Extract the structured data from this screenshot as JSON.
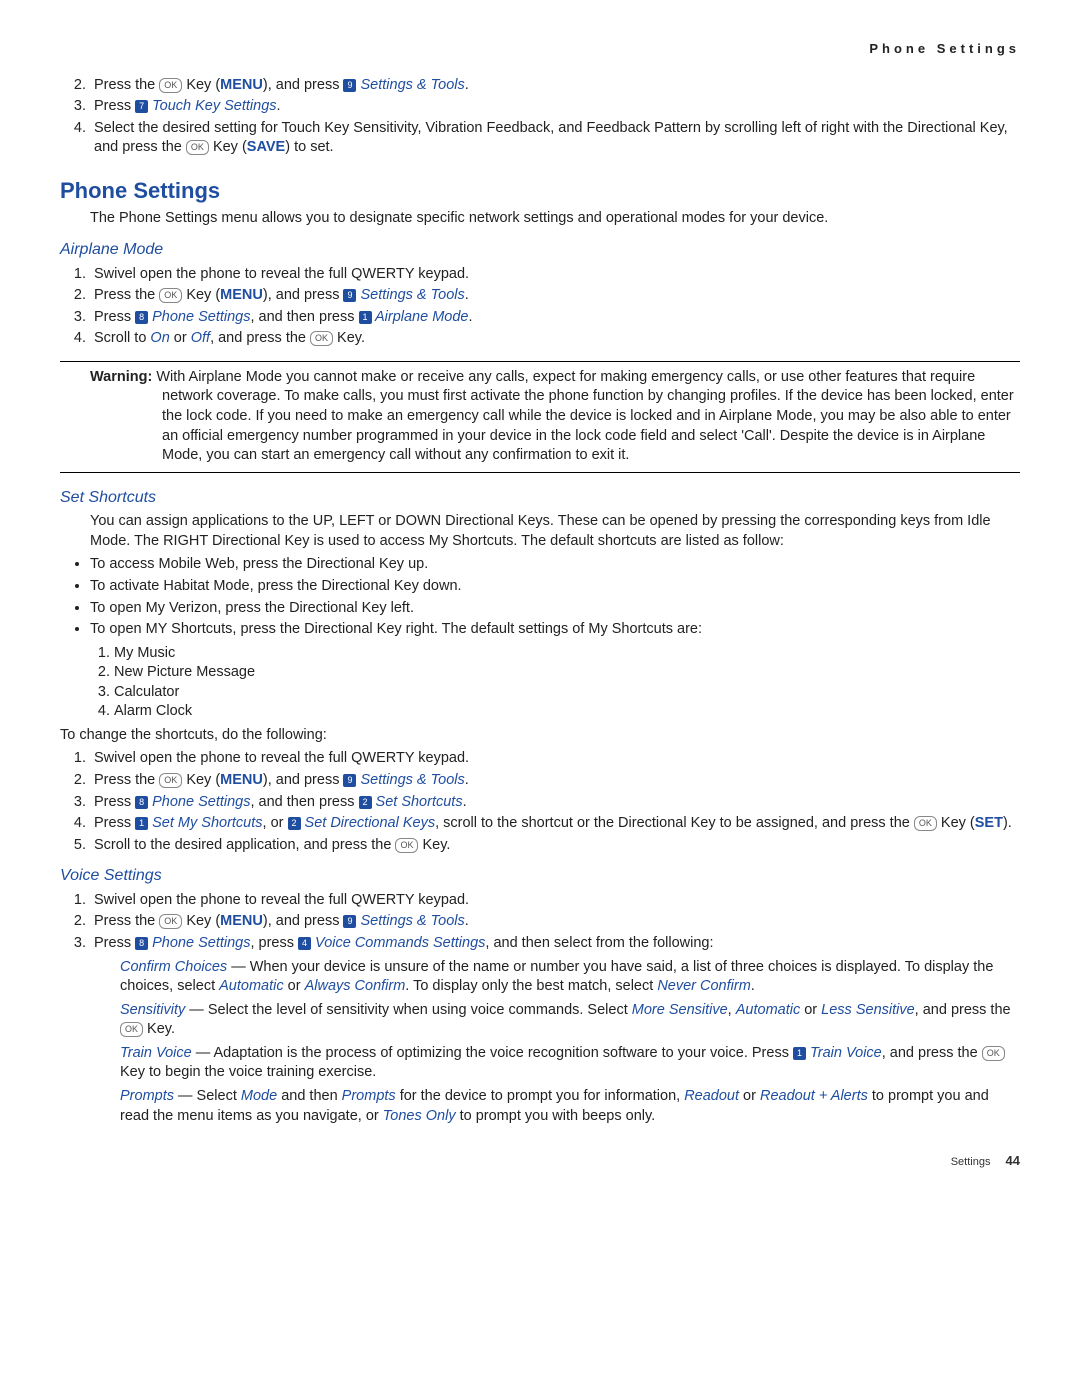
{
  "header": {
    "title": "Phone Settings"
  },
  "intro_steps": {
    "s2": {
      "pre": "Press the ",
      "key": "OK",
      "mid": " Key (",
      "menu": "MENU",
      "mid2": "), and press ",
      "nk": "9",
      "link": " Settings & Tools",
      "post": "."
    },
    "s3": {
      "pre": "Press ",
      "nk": "7",
      "link": " Touch Key Settings",
      "post": "."
    },
    "s4": {
      "pre": "Select the desired setting for Touch Key Sensitivity, Vibration Feedback, and Feedback Pattern by scrolling left of right with the Directional Key, and press the ",
      "key": "OK",
      "mid": " Key (",
      "menu": "SAVE",
      "post": ") to set."
    }
  },
  "phone_settings": {
    "title": "Phone Settings",
    "intro": "The Phone Settings menu allows you to designate specific network settings and operational modes for your device."
  },
  "airplane": {
    "title": "Airplane Mode",
    "s1": "Swivel open the phone to reveal the full QWERTY keypad.",
    "s2": {
      "pre": "Press the ",
      "key": "OK",
      "mid": " Key (",
      "menu": "MENU",
      "mid2": "), and press ",
      "nk": "9",
      "link": " Settings & Tools",
      "post": "."
    },
    "s3": {
      "pre": "Press ",
      "nk1": "8",
      "link1": " Phone Settings",
      "mid": ", and then press ",
      "nk2": "1",
      "link2": " Airplane Mode",
      "post": "."
    },
    "s4": {
      "pre": "Scroll to ",
      "on": "On",
      "mid": " or ",
      "off": "Off",
      "mid2": ", and press the ",
      "key": "OK",
      "post": " Key."
    },
    "warning_label": "Warning: ",
    "warning": "With Airplane Mode you cannot make or receive any calls, expect for making emergency calls, or use other features that require network coverage. To make calls, you must first activate the phone function by changing profiles. If the device has been locked, enter the lock code. If you need to make an emergency call while the device is locked and in Airplane Mode, you may be also able to enter an official emergency number programmed in your device in the lock code field and select 'Call'. Despite the device is in Airplane Mode, you can start an emergency call without any confirmation to exit it."
  },
  "shortcuts": {
    "title": "Set Shortcuts",
    "intro": "You can assign applications to the UP, LEFT or DOWN Directional Keys. These can be opened by pressing the corresponding keys from Idle Mode. The RIGHT Directional Key is used to access My Shortcuts. The default shortcuts are listed as follow:",
    "b1": "To access Mobile Web, press the Directional Key up.",
    "b2": "To activate Habitat Mode, press the Directional Key down.",
    "b3": "To open My Verizon, press the Directional Key left.",
    "b4": "To open MY Shortcuts, press the Directional Key right. The default settings of My Shortcuts are:",
    "d1": "My Music",
    "d2": "New Picture Message",
    "d3": "Calculator",
    "d4": "Alarm Clock",
    "change": "To change the shortcuts, do the following:",
    "s1": "Swivel open the phone to reveal the full QWERTY keypad.",
    "s2": {
      "pre": "Press the ",
      "key": "OK",
      "mid": " Key (",
      "menu": "MENU",
      "mid2": "), and press ",
      "nk": "9",
      "link": " Settings & Tools",
      "post": "."
    },
    "s3": {
      "pre": "Press ",
      "nk1": "8",
      "link1": " Phone Settings",
      "mid": ", and then press ",
      "nk2": "2",
      "link2": " Set Shortcuts",
      "post": "."
    },
    "s4": {
      "pre": "Press ",
      "nk1": "1",
      "link1": " Set My Shortcuts",
      "mid": ", or ",
      "nk2": "2",
      "link2": " Set Directional Keys",
      "mid2": ", scroll to the shortcut or the Directional Key to be assigned, and press the ",
      "key": "OK",
      "mid3": " Key (",
      "menu": "SET",
      "post": ")."
    },
    "s5": {
      "pre": "Scroll to the desired application, and press the ",
      "key": "OK",
      "post": " Key."
    }
  },
  "voice": {
    "title": "Voice Settings",
    "s1": "Swivel open the phone to reveal the full QWERTY keypad.",
    "s2": {
      "pre": "Press the ",
      "key": "OK",
      "mid": " Key (",
      "menu": "MENU",
      "mid2": "), and press ",
      "nk": "9",
      "link": " Settings & Tools",
      "post": "."
    },
    "s3": {
      "pre": "Press ",
      "nk1": "8",
      "link1": " Phone Settings",
      "mid": ", press ",
      "nk2": "4",
      "link2": " Voice Commands Settings",
      "post": ", and then select from the following:"
    },
    "confirm": {
      "t": "Confirm Choices",
      "body1": " — When your device is unsure of the name or number you have said, a list of three choices is displayed. To display the choices, select ",
      "auto": "Automatic",
      "or": " or ",
      "always": "Always Confirm",
      "body2": ". To display only the best match, select ",
      "never": "Never Confirm",
      "post": "."
    },
    "sens": {
      "t": "Sensitivity",
      "body1": " — Select the level of sensitivity when using voice commands. Select ",
      "more": "More Sensitive",
      "c1": ", ",
      "auto": "Automatic",
      "c2": " or ",
      "less": "Less Sensitive",
      "body2": ", and press the ",
      "key": "OK",
      "post": " Key."
    },
    "train": {
      "t": "Train Voice",
      "body1": " — Adaptation is the process of optimizing the voice recognition software to your voice. Press ",
      "nk": "1",
      "link": " Train Voice",
      "body2": ", and press the ",
      "key": "OK",
      "post": " Key to begin the voice training exercise."
    },
    "prompts": {
      "t": "Prompts",
      "s": " — Select ",
      "mode": "Mode",
      "a": " and then ",
      "p2": "Prompts",
      "b": " for the device to prompt you for information, ",
      "ro": "Readout",
      "or": " or ",
      "roa": "Readout + Alerts",
      "c": " to prompt you and read the menu items as you navigate, or ",
      "tones": "Tones Only",
      "d": " to prompt you with beeps only."
    }
  },
  "footer": {
    "section": "Settings",
    "page": "44"
  }
}
